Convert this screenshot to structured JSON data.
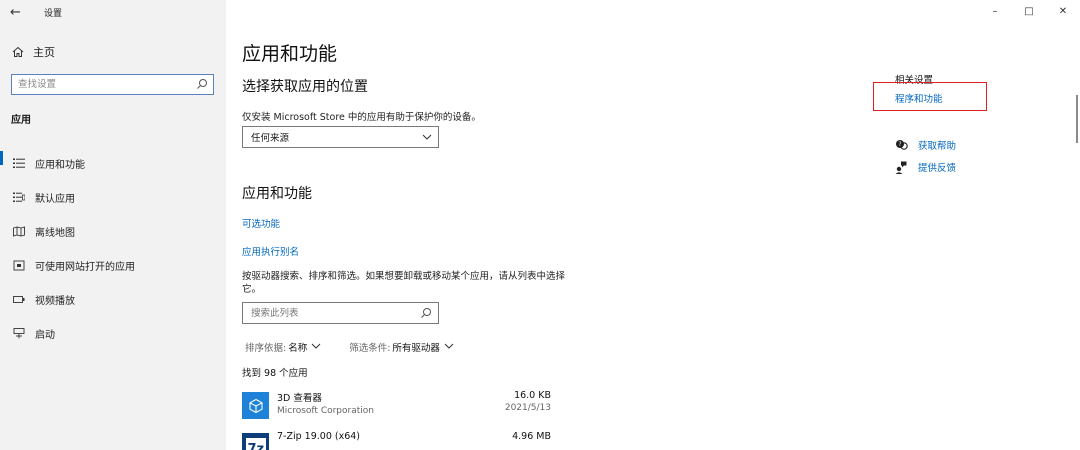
{
  "window": {
    "title": "设置",
    "controls": {
      "minimize": "–",
      "maximize": "□",
      "close": "✕"
    }
  },
  "sidebar": {
    "home_label": "主页",
    "search_placeholder": "查找设置",
    "section_label": "应用",
    "items": [
      {
        "label": "应用和功能",
        "icon": "apps-list-icon",
        "active": true
      },
      {
        "label": "默认应用",
        "icon": "default-apps-icon",
        "active": false
      },
      {
        "label": "离线地图",
        "icon": "offline-map-icon",
        "active": false
      },
      {
        "label": "可使用网站打开的应用",
        "icon": "website-apps-icon",
        "active": false
      },
      {
        "label": "视频播放",
        "icon": "video-playback-icon",
        "active": false
      },
      {
        "label": "启动",
        "icon": "startup-icon",
        "active": false
      }
    ]
  },
  "main": {
    "page_title": "应用和功能",
    "choose_section": {
      "heading": "选择获取应用的位置",
      "description": "仅安装 Microsoft Store 中的应用有助于保护你的设备。",
      "dropdown_value": "任何来源"
    },
    "apps_section": {
      "heading": "应用和功能",
      "link_optional": "可选功能",
      "link_aliases": "应用执行别名",
      "description": "按驱动器搜索、排序和筛选。如果想要卸载或移动某个应用，请从列表中选择它。",
      "search_placeholder": "搜索此列表",
      "sort_label": "排序依据:",
      "sort_value": "名称",
      "filter_label": "筛选条件:",
      "filter_value": "所有驱动器",
      "count_text": "找到 98 个应用",
      "apps": [
        {
          "name": "3D 查看器",
          "publisher": "Microsoft Corporation",
          "size": "16.0 KB",
          "date": "2021/5/13"
        },
        {
          "name": "7-Zip 19.00 (x64)",
          "publisher": "",
          "size": "4.96 MB",
          "date": ""
        }
      ]
    }
  },
  "related": {
    "title": "相关设置",
    "link": "程序和功能",
    "get_help": "获取帮助",
    "feedback": "提供反馈"
  },
  "colors": {
    "accent": "#0067c0",
    "sidebar_bg": "#f2f2f2",
    "highlight": "#e02020"
  }
}
